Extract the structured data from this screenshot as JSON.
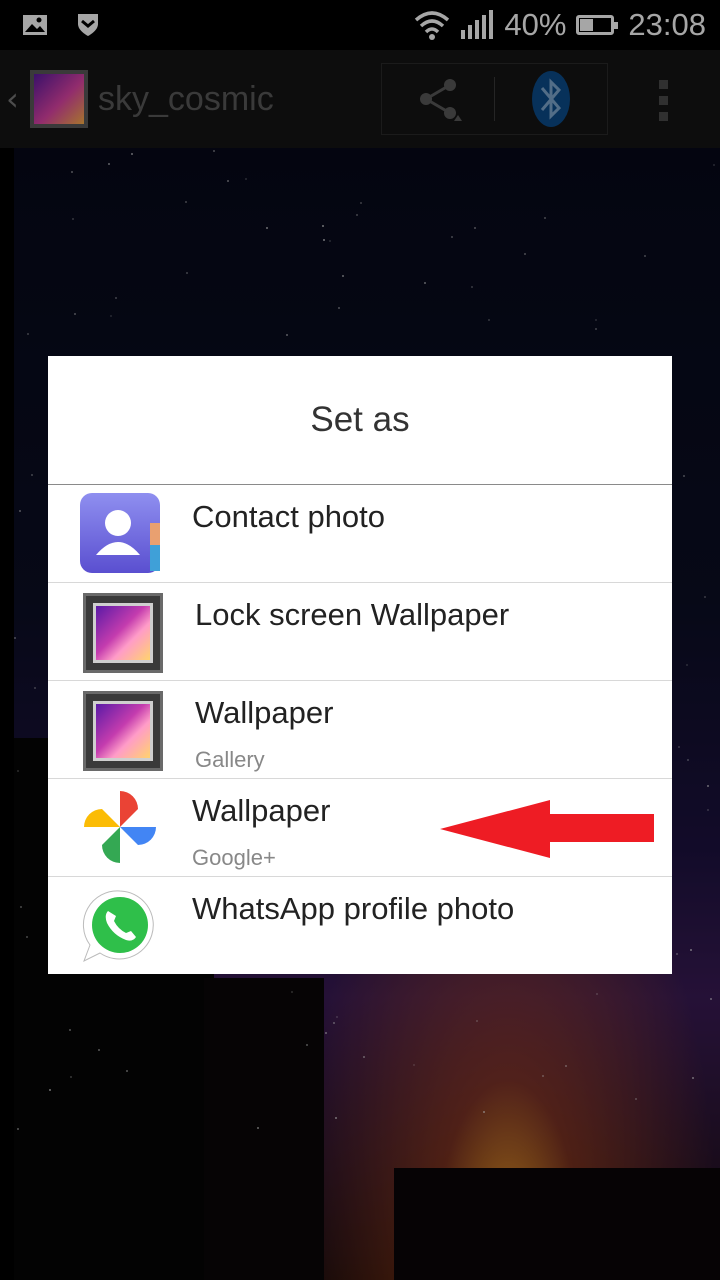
{
  "status_bar": {
    "battery_percent": "40%",
    "battery_level": 0.4,
    "time": "23:08",
    "icons": [
      "image-notification-icon",
      "shield-notification-icon",
      "wifi-icon",
      "signal-icon",
      "battery-icon"
    ]
  },
  "action_bar": {
    "title": "sky_cosmic",
    "actions": [
      "share-icon",
      "bluetooth-icon",
      "overflow-menu-icon"
    ]
  },
  "dialog": {
    "title": "Set as",
    "items": [
      {
        "label": "Contact photo",
        "sublabel": "",
        "icon": "contacts-app-icon"
      },
      {
        "label": "Lock screen Wallpaper",
        "sublabel": "",
        "icon": "gallery-app-icon"
      },
      {
        "label": "Wallpaper",
        "sublabel": "Gallery",
        "icon": "gallery-app-icon"
      },
      {
        "label": "Wallpaper",
        "sublabel": "Google+",
        "icon": "google-photos-icon"
      },
      {
        "label": "WhatsApp profile photo",
        "sublabel": "",
        "icon": "whatsapp-icon"
      }
    ]
  },
  "annotation": {
    "color": "#ee1c24",
    "points_to": "Wallpaper Google+"
  }
}
